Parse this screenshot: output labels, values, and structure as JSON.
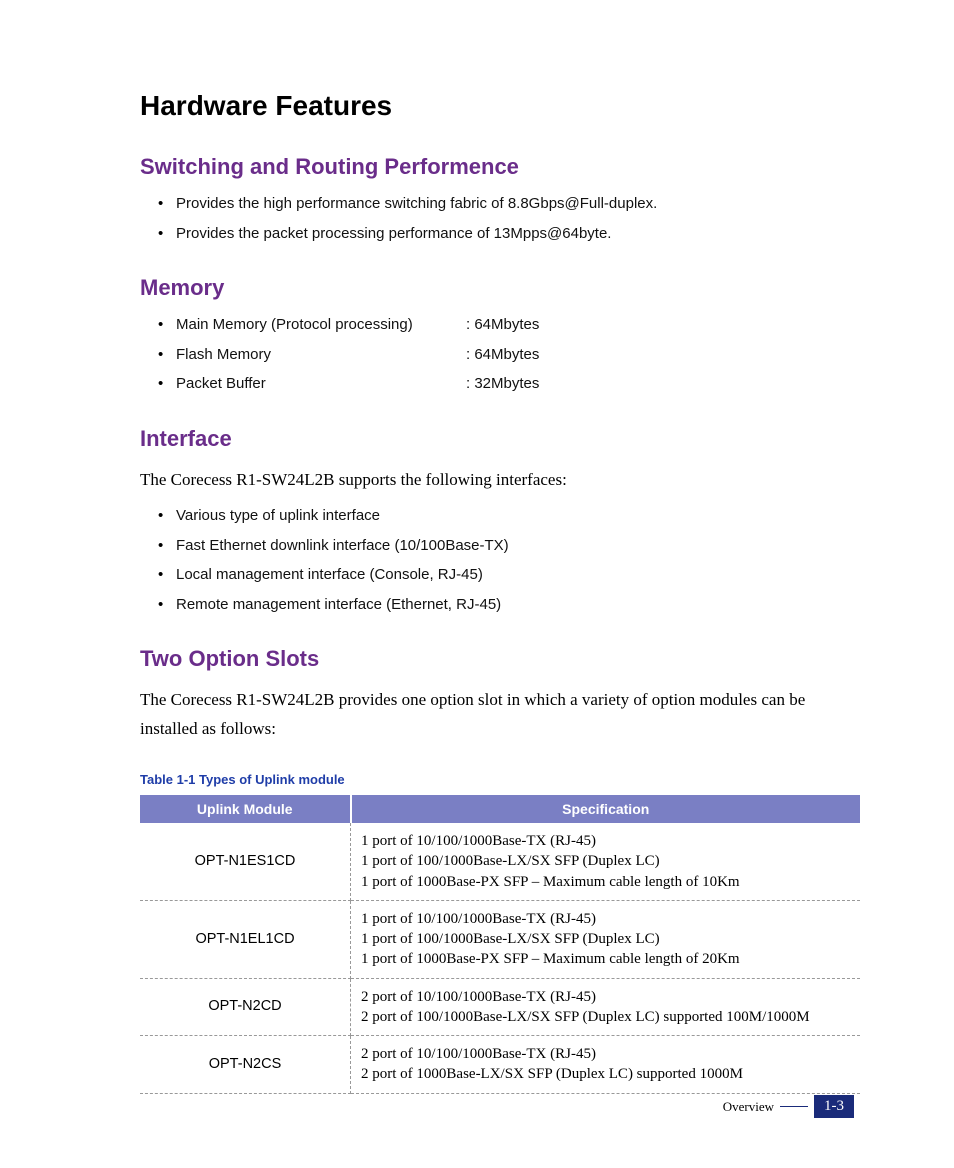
{
  "title": "Hardware Features",
  "sections": {
    "switching": {
      "heading": "Switching and Routing Performence",
      "items": [
        "Provides the high performance switching fabric of 8.8Gbps@Full-duplex.",
        "Provides the packet processing performance of 13Mpps@64byte."
      ]
    },
    "memory": {
      "heading": "Memory",
      "rows": [
        {
          "label": "Main Memory (Protocol processing)",
          "value": ":  64Mbytes"
        },
        {
          "label": "Flash Memory",
          "value": ": 64Mbytes"
        },
        {
          "label": "Packet Buffer",
          "value": ": 32Mbytes"
        }
      ]
    },
    "interface": {
      "heading": "Interface",
      "intro": "The Corecess R1-SW24L2B supports the following interfaces:",
      "items": [
        "Various type of uplink interface",
        "Fast Ethernet downlink interface (10/100Base-TX)",
        "Local management interface (Console, RJ-45)",
        "Remote management interface (Ethernet, RJ-45)"
      ]
    },
    "slots": {
      "heading": "Two Option Slots",
      "intro": "The Corecess R1-SW24L2B provides one option slot in which a variety of option modules can be installed as follows:",
      "table_caption": "Table 1-1    Types of Uplink module",
      "headers": {
        "col1": "Uplink Module",
        "col2": "Specification"
      },
      "rows": [
        {
          "module": "OPT-N1ES1CD",
          "spec": "1 port of 10/100/1000Base-TX (RJ-45)\n1 port of 100/1000Base-LX/SX SFP (Duplex LC)\n1 port of 1000Base-PX SFP – Maximum cable length of 10Km"
        },
        {
          "module": "OPT-N1EL1CD",
          "spec": "1 port of 10/100/1000Base-TX (RJ-45)\n1 port of 100/1000Base-LX/SX SFP (Duplex LC)\n1 port of 1000Base-PX SFP – Maximum cable length of 20Km"
        },
        {
          "module": "OPT-N2CD",
          "spec": "2 port of 10/100/1000Base-TX (RJ-45)\n2 port of 100/1000Base-LX/SX SFP (Duplex LC) supported 100M/1000M"
        },
        {
          "module": "OPT-N2CS",
          "spec": "2 port of 10/100/1000Base-TX (RJ-45)\n2 port of 1000Base-LX/SX SFP (Duplex LC) supported 1000M"
        }
      ]
    }
  },
  "footer": {
    "label": "Overview",
    "page": "1-3"
  }
}
